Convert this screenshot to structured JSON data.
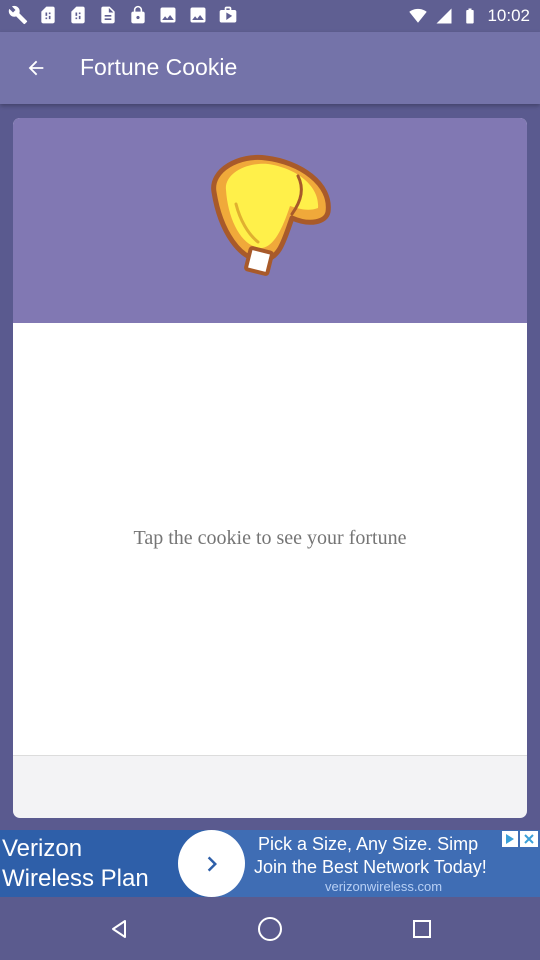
{
  "status_bar": {
    "icons": [
      "wrench-icon",
      "sim-card-icon",
      "sim-card-icon",
      "document-icon",
      "lock-icon",
      "photo-icon",
      "photo-icon",
      "play-store-icon"
    ],
    "time": "10:02",
    "right_icons": [
      "wifi-icon",
      "signal-icon",
      "battery-icon"
    ]
  },
  "app_bar": {
    "title": "Fortune Cookie",
    "back_icon": "arrow-back-icon"
  },
  "card": {
    "header_color": "#8178b3",
    "cookie_icon": "fortune-cookie-icon",
    "instruction": "Tap the cookie to see your fortune"
  },
  "ad": {
    "brand": "Verizon Wireless Plan",
    "line1": "Pick a Size, Any Size. Simp",
    "line2": "Join the Best Network Today!",
    "domain": "verizonwireless.com",
    "arrow_icon": "chevron-right-icon",
    "choices_icon": "ad-choices-icon",
    "close_icon": "close-icon"
  },
  "nav_bar": {
    "back": "nav-back-icon",
    "home": "nav-home-icon",
    "recents": "nav-recents-icon"
  },
  "colors": {
    "app_bar": "#7473a9",
    "status_bar": "#5f5f92",
    "card_header": "#8178b3",
    "ad_blue": "#3f6db4"
  }
}
